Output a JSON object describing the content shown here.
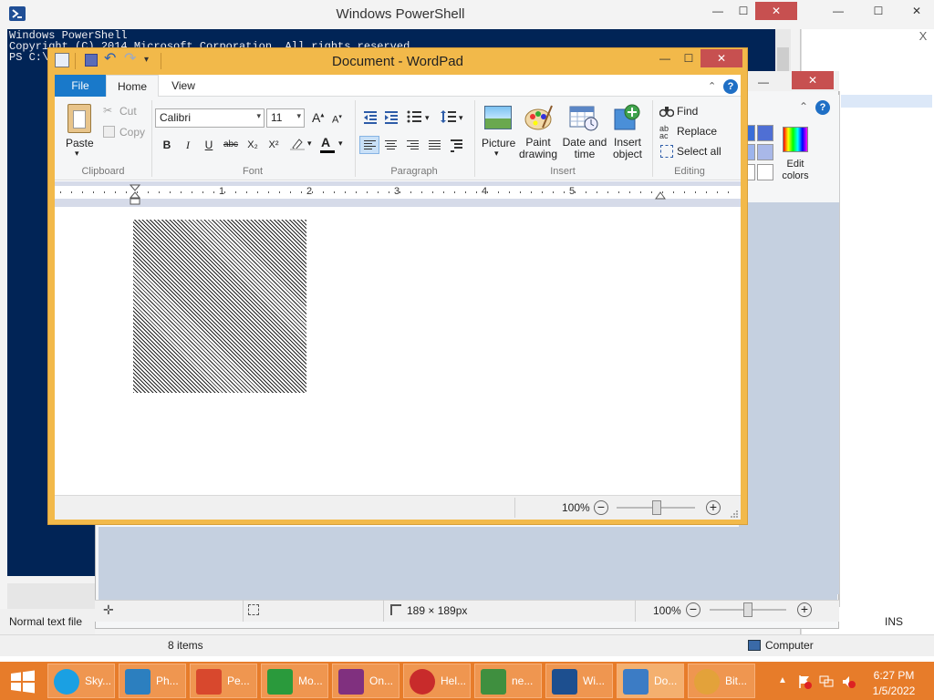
{
  "powershell": {
    "title": "Windows PowerShell",
    "console_lines": [
      "Windows PowerShell",
      "Copyright (C) 2014 Microsoft Corporation. All rights reserved.",
      "",
      "PS C:\\"
    ]
  },
  "right_window": {
    "close_label": "X"
  },
  "paint": {
    "edit_colors_label": "Edit\ncolors",
    "status": {
      "size": "189 × 189px",
      "zoom": "100%"
    }
  },
  "left_panel": {
    "normal_text": "Normal text file"
  },
  "explorer": {
    "items_count": "8 items",
    "location": "Computer",
    "ins": "INS"
  },
  "wordpad": {
    "title": "Document - WordPad",
    "tabs": {
      "file": "File",
      "home": "Home",
      "view": "View"
    },
    "clipboard": {
      "paste": "Paste",
      "cut": "Cut",
      "copy": "Copy",
      "group": "Clipboard"
    },
    "font": {
      "family": "Calibri",
      "size": "11",
      "group": "Font",
      "bold": "B",
      "italic": "I",
      "underline": "U",
      "strike": "abc",
      "sub": "X₂",
      "sup": "X²",
      "color_letter": "A"
    },
    "paragraph": {
      "group": "Paragraph"
    },
    "insert": {
      "picture": "Picture",
      "paint": "Paint\ndrawing",
      "datetime": "Date and\ntime",
      "object": "Insert\nobject",
      "group": "Insert"
    },
    "editing": {
      "find": "Find",
      "replace": "Replace",
      "select_all": "Select all",
      "group": "Editing"
    },
    "ruler_numbers": [
      "1",
      "2",
      "3",
      "4",
      "5"
    ],
    "status": {
      "zoom": "100%"
    }
  },
  "taskbar": {
    "items": [
      {
        "label": "Sky...",
        "color": "#1aa0e3"
      },
      {
        "label": "Ph...",
        "color": "#2c7fbf"
      },
      {
        "label": "Pe...",
        "color": "#d8482d"
      },
      {
        "label": "Mo...",
        "color": "#2a9a3c"
      },
      {
        "label": "On...",
        "color": "#80307f"
      },
      {
        "label": "Hel...",
        "color": "#c82b2b"
      },
      {
        "label": "ne...",
        "color": "#3f8f3f"
      },
      {
        "label": "Wi...",
        "color": "#1d4f8f"
      },
      {
        "label": "Do...",
        "color": "#3c7cc5"
      },
      {
        "label": "Bit...",
        "color": "#e3a23a"
      }
    ],
    "clock": {
      "time": "6:27 PM",
      "date": "1/5/2022"
    }
  },
  "colors": {
    "taskbar": "#e77c2a",
    "wordpad_frame": "#f2b94a",
    "console": "#012456",
    "file_tab": "#1979ca"
  }
}
